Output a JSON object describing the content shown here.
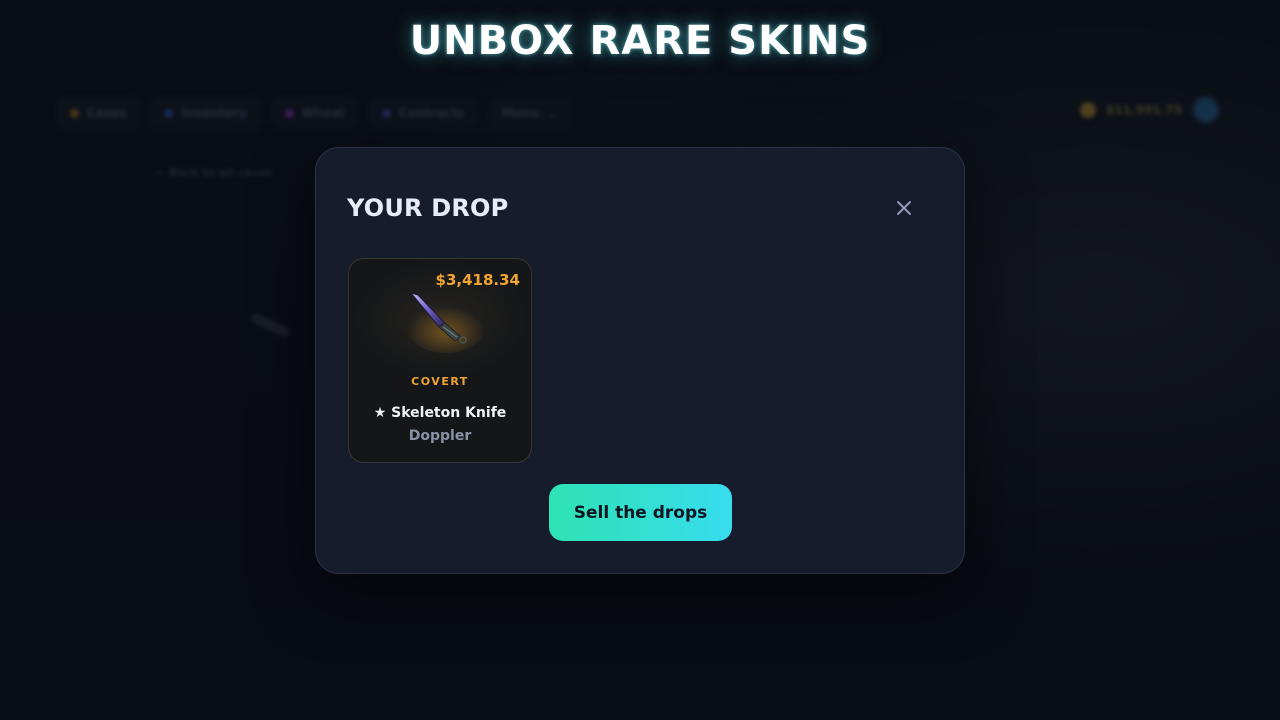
{
  "headline": "UNBOX RARE SKINS",
  "background": {
    "nav": [
      {
        "label": "Cases",
        "color": "#b8862a"
      },
      {
        "label": "Inventory",
        "color": "#2f5fd0"
      },
      {
        "label": "Wheel",
        "color": "#9b3fd0"
      },
      {
        "label": "Contracts",
        "color": "#5b4fd6"
      },
      {
        "label": "Menu",
        "color": ""
      }
    ],
    "balance": "$11,991.75",
    "back_link": "← Back to all cases"
  },
  "modal": {
    "title": "YOUR DROP",
    "close_icon": "close-icon",
    "drop": {
      "price": "$3,418.34",
      "rarity": "COVERT",
      "name": "★ Skeleton Knife",
      "finish": "Doppler",
      "rarity_color": "#f0a533"
    },
    "sell_button": "Sell the drops"
  },
  "colors": {
    "accent_start": "#2ee3b4",
    "accent_end": "#38dcee",
    "modal_bg": "#171c2d"
  }
}
